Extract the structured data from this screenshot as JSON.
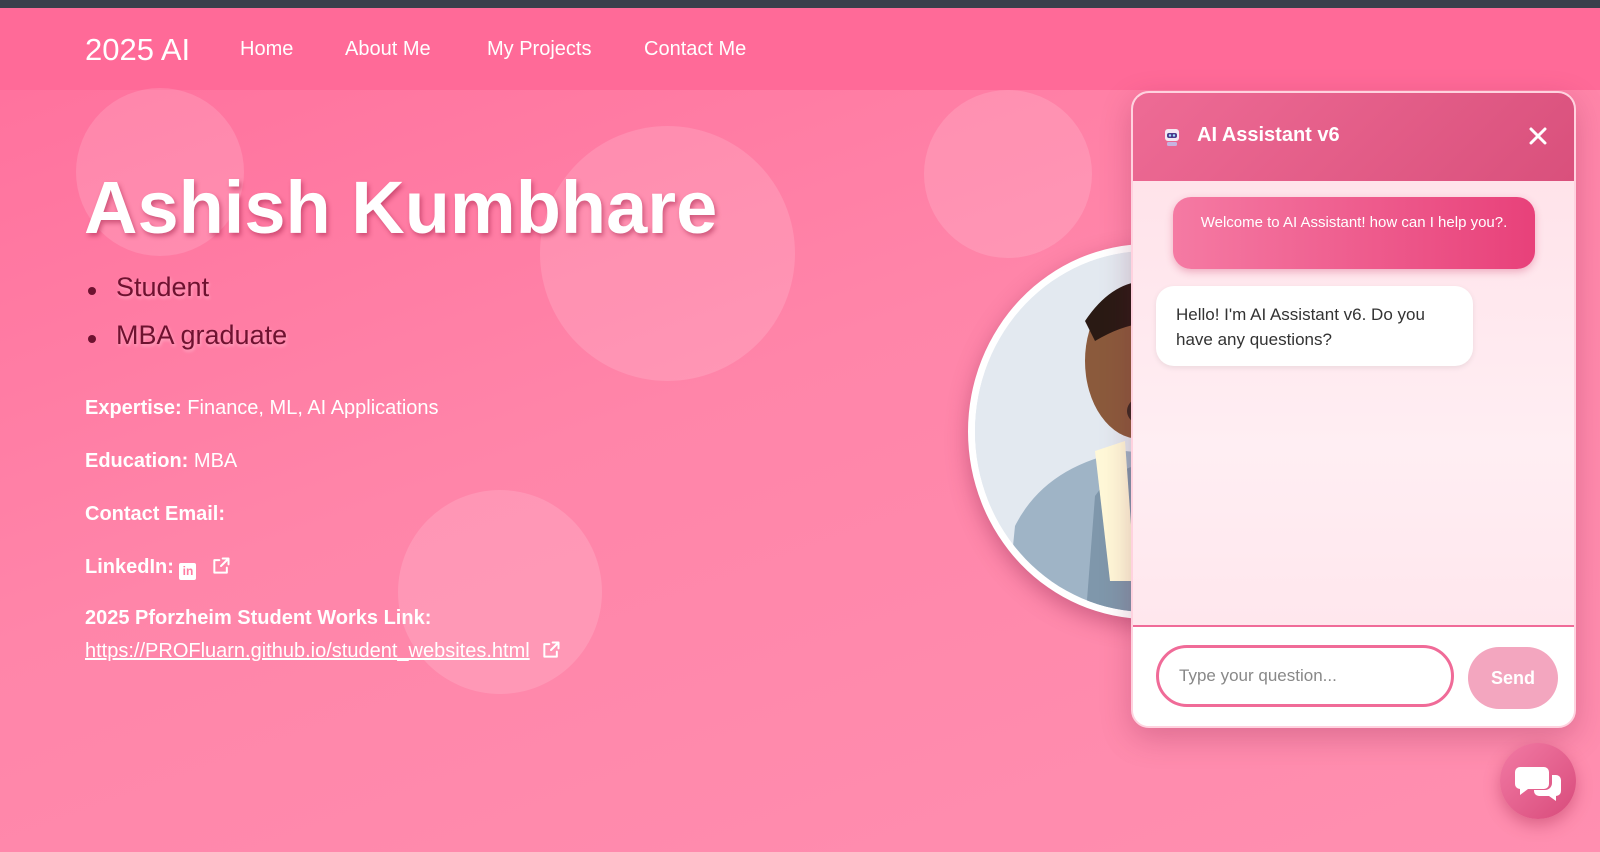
{
  "nav": {
    "brand": "2025 AI",
    "links": [
      "Home",
      "About Me",
      "My Projects",
      "Contact Me"
    ]
  },
  "hero": {
    "name": "Ashish Kumbhare",
    "roles": [
      "Student",
      "MBA graduate"
    ]
  },
  "info": {
    "expertise_label": "Expertise:",
    "expertise_value": "Finance, ML, AI Applications",
    "education_label": "Education:",
    "education_value": "MBA",
    "email_label": "Contact Email:",
    "linkedin_label": "LinkedIn:",
    "works_label": "2025 Pforzheim Student Works Link:",
    "works_url": "https://PROFluarn.github.io/student_websites.html"
  },
  "chat": {
    "title": "AI Assistant v6",
    "welcome": "Welcome to AI Assistant! how can I help you?.",
    "bot_message": "Hello! I'm AI Assistant v6. Do you have any questions?",
    "input_placeholder": "Type your question...",
    "send_label": "Send"
  },
  "icons": {
    "robot": "robot-icon",
    "close": "close-icon",
    "linkedin": "linkedin-icon",
    "external": "external-link-icon",
    "chat_fab": "chat-bubbles-icon"
  },
  "colors": {
    "brand_pink": "#ff6a98",
    "accent": "#e8417a",
    "role_text": "#6e1230"
  }
}
